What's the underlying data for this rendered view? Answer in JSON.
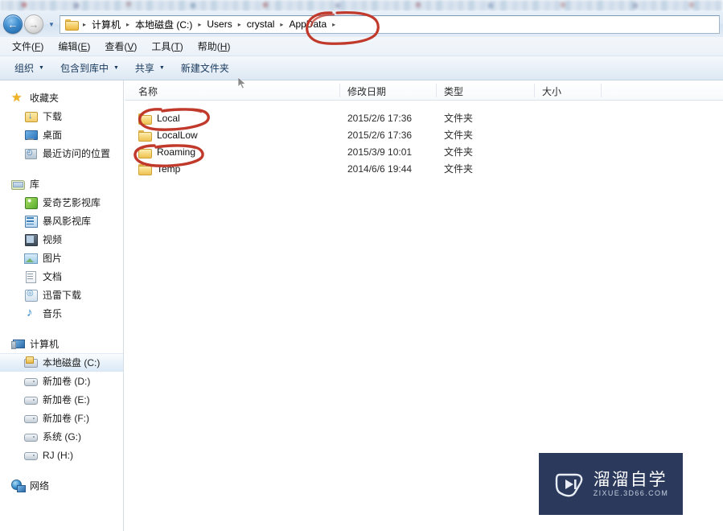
{
  "window": {
    "nav": {
      "back_label": "←",
      "forward_label": "→",
      "history_label": "▼"
    },
    "address": {
      "folder_icon": "folder-icon",
      "separator": "▸",
      "breadcrumbs": [
        {
          "label": "计算机"
        },
        {
          "label": "本地磁盘 (C:)"
        },
        {
          "label": "Users"
        },
        {
          "label": "crystal"
        },
        {
          "label": "AppData"
        }
      ],
      "trailing_separator": "▸"
    }
  },
  "menubar": {
    "items": [
      {
        "text": "文件",
        "mnemonic": "F"
      },
      {
        "text": "编辑",
        "mnemonic": "E"
      },
      {
        "text": "查看",
        "mnemonic": "V"
      },
      {
        "text": "工具",
        "mnemonic": "T"
      },
      {
        "text": "帮助",
        "mnemonic": "H"
      }
    ]
  },
  "toolbar": {
    "items": [
      {
        "label": "组织",
        "has_caret": true
      },
      {
        "label": "包含到库中",
        "has_caret": true
      },
      {
        "label": "共享",
        "has_caret": true
      },
      {
        "label": "新建文件夹",
        "has_caret": false
      }
    ],
    "caret_glyph": "▼"
  },
  "sidebar": {
    "groups": [
      {
        "header": {
          "label": "收藏夹",
          "icon": "star-icon"
        },
        "items": [
          {
            "label": "下载",
            "icon": "download-folder-icon"
          },
          {
            "label": "桌面",
            "icon": "desktop-icon"
          },
          {
            "label": "最近访问的位置",
            "icon": "recent-places-icon"
          }
        ]
      },
      {
        "header": {
          "label": "库",
          "icon": "library-icon"
        },
        "items": [
          {
            "label": "爱奇艺影视库",
            "icon": "iqiyi-icon"
          },
          {
            "label": "暴风影视库",
            "icon": "baofeng-icon"
          },
          {
            "label": "视频",
            "icon": "video-icon"
          },
          {
            "label": "图片",
            "icon": "picture-icon"
          },
          {
            "label": "文档",
            "icon": "document-icon"
          },
          {
            "label": "迅雷下载",
            "icon": "xunlei-icon"
          },
          {
            "label": "音乐",
            "icon": "music-icon"
          }
        ]
      },
      {
        "header": {
          "label": "计算机",
          "icon": "computer-icon"
        },
        "items": [
          {
            "label": "本地磁盘 (C:)",
            "icon": "hard-disk-c-icon",
            "selected": true
          },
          {
            "label": "新加卷 (D:)",
            "icon": "hard-disk-icon",
            "selected": false
          },
          {
            "label": "新加卷 (E:)",
            "icon": "hard-disk-icon",
            "selected": false
          },
          {
            "label": "新加卷 (F:)",
            "icon": "hard-disk-icon",
            "selected": false
          },
          {
            "label": "系统 (G:)",
            "icon": "hard-disk-icon",
            "selected": false
          },
          {
            "label": "RJ (H:)",
            "icon": "hard-disk-icon",
            "selected": false
          }
        ]
      },
      {
        "header": {
          "label": "网络",
          "icon": "network-icon"
        },
        "items": []
      }
    ]
  },
  "file_list": {
    "columns": [
      {
        "label": "名称"
      },
      {
        "label": "修改日期"
      },
      {
        "label": "类型"
      },
      {
        "label": "大小"
      }
    ],
    "rows": [
      {
        "name": "Local",
        "date": "2015/2/6 17:36",
        "type": "文件夹",
        "size": "",
        "icon": "folder-icon"
      },
      {
        "name": "LocalLow",
        "date": "2015/2/6 17:36",
        "type": "文件夹",
        "size": "",
        "icon": "folder-icon"
      },
      {
        "name": "Roaming",
        "date": "2015/3/9 10:01",
        "type": "文件夹",
        "size": "",
        "icon": "folder-icon"
      },
      {
        "name": "Temp",
        "date": "2014/6/6 19:44",
        "type": "文件夹",
        "size": "",
        "icon": "folder-icon"
      }
    ]
  },
  "annotations": {
    "color": "#c0392b",
    "marks": [
      {
        "target": "AppData",
        "shape": "ellipse"
      },
      {
        "target": "Local",
        "shape": "ellipse"
      },
      {
        "target": "Roaming",
        "shape": "ellipse"
      }
    ]
  },
  "watermark": {
    "cn_text": "溜溜自学",
    "en_text": "ZIXUE.3D66.COM",
    "bg_color": "#2b3a5c",
    "icon": "play-logo-icon"
  }
}
